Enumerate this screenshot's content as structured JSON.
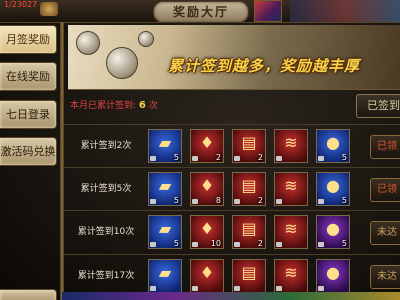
{
  "topbar": {
    "hp_readout": "1/23027",
    "panel_title": "奖励大厅"
  },
  "tabs": [
    {
      "label": "月签奖励"
    },
    {
      "label": "在线奖励"
    },
    {
      "label": "七日登录"
    },
    {
      "label": "激活码兑换"
    },
    {
      "label": ""
    }
  ],
  "banner": {
    "slogan": "累计签到越多，奖励越丰厚"
  },
  "checkin": {
    "count_prefix": "本月已累计签到:",
    "count_value": "6",
    "count_unit": "次",
    "signed_button": "已签到"
  },
  "rewards": [
    {
      "label": "累计签到2次",
      "status": "已领",
      "items": [
        {
          "kind": "gold-ingot",
          "rarity": "blue",
          "qty": "5",
          "icon": "▰"
        },
        {
          "kind": "red-pouch",
          "rarity": "red",
          "qty": "2",
          "icon": "♦"
        },
        {
          "kind": "red-book",
          "rarity": "red",
          "qty": "2",
          "icon": "▤"
        },
        {
          "kind": "scroll",
          "rarity": "red",
          "qty": "",
          "icon": "≋"
        },
        {
          "kind": "gold-orb",
          "rarity": "blue",
          "qty": "5",
          "icon": "●"
        }
      ]
    },
    {
      "label": "累计签到5次",
      "status": "已领",
      "items": [
        {
          "kind": "gold-ingot",
          "rarity": "blue",
          "qty": "5",
          "icon": "▰"
        },
        {
          "kind": "red-pouch",
          "rarity": "red",
          "qty": "8",
          "icon": "♦"
        },
        {
          "kind": "red-book",
          "rarity": "red",
          "qty": "2",
          "icon": "▤"
        },
        {
          "kind": "scroll",
          "rarity": "red",
          "qty": "",
          "icon": "≋"
        },
        {
          "kind": "gold-orb",
          "rarity": "blue",
          "qty": "5",
          "icon": "●"
        }
      ]
    },
    {
      "label": "累计签到10次",
      "status": "未达",
      "items": [
        {
          "kind": "gold-ingot",
          "rarity": "blue",
          "qty": "5",
          "icon": "▰"
        },
        {
          "kind": "red-pouch",
          "rarity": "red",
          "qty": "10",
          "icon": "♦"
        },
        {
          "kind": "red-book",
          "rarity": "red",
          "qty": "2",
          "icon": "▤"
        },
        {
          "kind": "scroll",
          "rarity": "red",
          "qty": "",
          "icon": "≋"
        },
        {
          "kind": "gold-orb",
          "rarity": "purple",
          "qty": "5",
          "icon": "●"
        }
      ]
    },
    {
      "label": "累计签到17次",
      "status": "未达",
      "items": [
        {
          "kind": "gold-ingot",
          "rarity": "blue",
          "qty": "",
          "icon": "▰"
        },
        {
          "kind": "red-pouch",
          "rarity": "red",
          "qty": "",
          "icon": "♦"
        },
        {
          "kind": "red-book",
          "rarity": "red",
          "qty": "",
          "icon": "▤"
        },
        {
          "kind": "scroll",
          "rarity": "red",
          "qty": "",
          "icon": "≋"
        },
        {
          "kind": "gold-orb",
          "rarity": "purple",
          "qty": "",
          "icon": "●"
        }
      ]
    }
  ],
  "colors": {
    "accent_gold": "#f8d24a",
    "count_red": "#e24444",
    "claimed_orange": "#e0582c"
  }
}
